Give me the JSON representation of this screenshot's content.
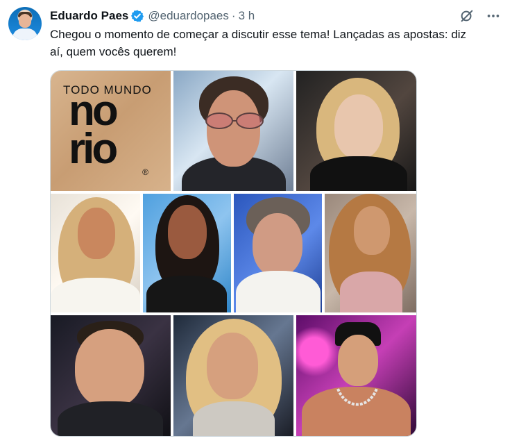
{
  "author": {
    "name": "Eduardo Paes",
    "handle": "@eduardopaes",
    "separator": "·",
    "time": "3 h"
  },
  "icons": {
    "verified": "verified-badge-icon",
    "grok": "grok-icon",
    "more": "more-icon"
  },
  "tweet": {
    "text": "Chegou o momento de começar a discutir esse tema!  Lançadas as apostas: diz aí, quem vocês querem!"
  },
  "media": {
    "logo": {
      "line1": "TODO MUNDO",
      "line2": "no",
      "line3": "rio",
      "mark": "®"
    }
  },
  "colors": {
    "accent": "#1d9bf0",
    "muted": "#536471",
    "border": "#cfd9de"
  }
}
